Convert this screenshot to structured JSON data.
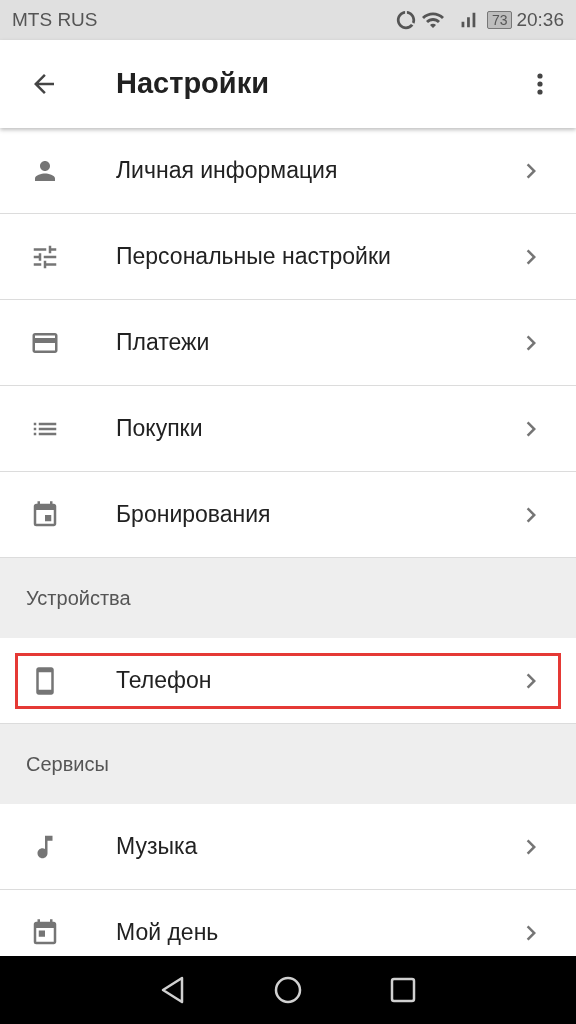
{
  "status_bar": {
    "carrier": "MTS RUS",
    "battery": "73",
    "time": "20:36"
  },
  "app_bar": {
    "title": "Настройки"
  },
  "list": [
    {
      "kind": "row",
      "label": "Личная информация",
      "highlighted": false
    },
    {
      "kind": "row",
      "label": "Персональные настройки",
      "highlighted": false
    },
    {
      "kind": "row",
      "label": "Платежи",
      "highlighted": false
    },
    {
      "kind": "row",
      "label": "Покупки",
      "highlighted": false
    },
    {
      "kind": "row",
      "label": "Бронирования",
      "highlighted": false
    },
    {
      "kind": "header",
      "label": "Устройства"
    },
    {
      "kind": "row",
      "label": "Телефон",
      "highlighted": true
    },
    {
      "kind": "header",
      "label": "Сервисы"
    },
    {
      "kind": "row",
      "label": "Музыка",
      "highlighted": false
    },
    {
      "kind": "row",
      "label": "Мой день",
      "highlighted": false
    }
  ]
}
